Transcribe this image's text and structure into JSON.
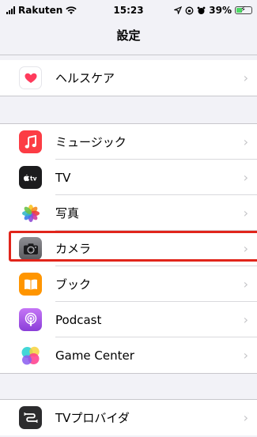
{
  "status_bar": {
    "carrier": "Rakuten",
    "time": "15:23",
    "battery": "39%",
    "battery_level": 0.39
  },
  "nav": {
    "title": "設定"
  },
  "group_health": [
    {
      "label": "ヘルスケア",
      "icon": "heart-icon"
    }
  ],
  "group_media": [
    {
      "label": "ミュージック",
      "icon": "music-note-icon"
    },
    {
      "label": "TV",
      "icon": "apple-tv-icon"
    },
    {
      "label": "写真",
      "icon": "photos-flower-icon"
    },
    {
      "label": "カメラ",
      "icon": "camera-icon"
    },
    {
      "label": "ブック",
      "icon": "book-icon"
    },
    {
      "label": "Podcast",
      "icon": "podcast-icon"
    },
    {
      "label": "Game Center",
      "icon": "game-center-icon"
    }
  ],
  "group_provider": [
    {
      "label": "TVプロバイダ",
      "icon": "tv-provider-icon"
    }
  ],
  "chevron": "›",
  "colors": {
    "highlight": "#e1251b",
    "music": "#fc3c44",
    "tv": "#1c1c1e",
    "camera": "#6e6e73",
    "books": "#ff9500",
    "podcast": "#9b59e6",
    "tv_provider": "#2c2c2e"
  }
}
